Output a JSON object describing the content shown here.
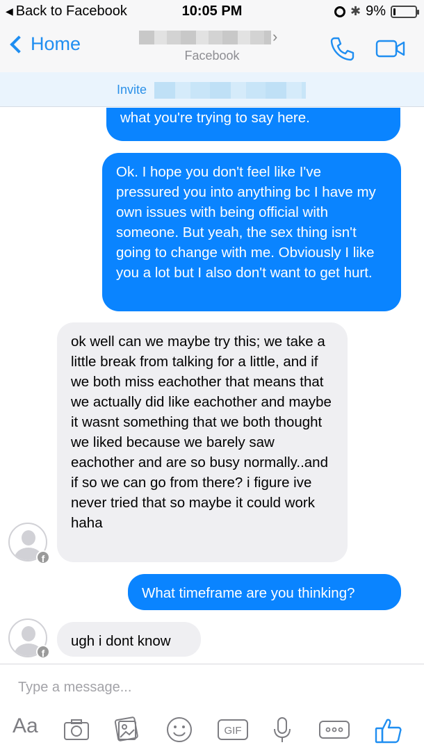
{
  "status_bar": {
    "back_label": "Back to Facebook",
    "time": "10:05 PM",
    "battery_percent": "9%",
    "battery_level": 0.09
  },
  "header": {
    "back_label": "Home",
    "subtitle": "Facebook",
    "accent_color": "#1f8ef1"
  },
  "invite_bar": {
    "label": "Invite"
  },
  "messages": [
    {
      "sender": "me",
      "text": "and I care about my own. I'm just not sure what you're trying to say here."
    },
    {
      "sender": "me",
      "text": "Ok. I hope you don't feel like I've pressured you into anything bc I have my own issues with being official with someone. But yeah, the sex thing isn't going to change with me. Obviously I like you a lot but I also don't want to get hurt."
    },
    {
      "sender": "them",
      "text": "ok well can we maybe try this; we take a little break from talking for a little, and if we both miss eachother that means that we actually did like eachother and maybe it wasnt something that we both thought we liked because we barely saw eachother and are so busy normally..and if so we can go from there? i figure ive never tried that so maybe it could work haha"
    },
    {
      "sender": "me",
      "text": "What timeframe are you thinking?"
    },
    {
      "sender": "them",
      "text": "ugh i dont know"
    }
  ],
  "composer": {
    "placeholder": "Type a message...",
    "aa_label": "Aa",
    "gif_label": "GIF",
    "icons": [
      "camera-icon",
      "photo-gallery-icon",
      "emoji-icon",
      "gif-icon",
      "microphone-icon",
      "more-icon",
      "thumbs-up-icon"
    ]
  },
  "colors": {
    "outgoing_bubble": "#0a84ff",
    "incoming_bubble": "#efeff2"
  }
}
